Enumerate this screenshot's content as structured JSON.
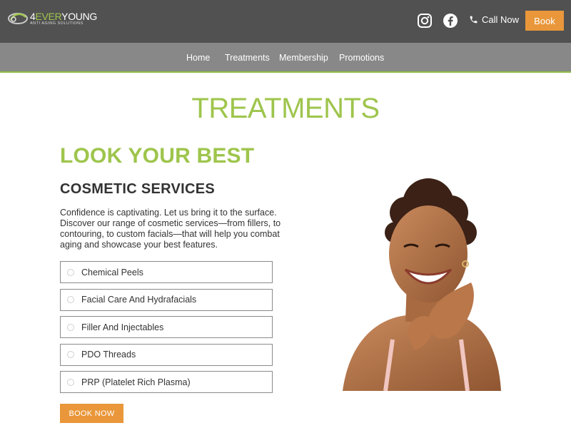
{
  "header": {
    "logo_name_prefix": "4",
    "logo_name_green": "EVER",
    "logo_name_suffix": "YOUNG",
    "logo_tagline": "ANTI AGING SOLUTIONS",
    "call_label": "Call Now",
    "book_label": "Book",
    "icons": [
      "instagram-icon",
      "facebook-icon",
      "phone-icon"
    ]
  },
  "nav": {
    "items": [
      {
        "label": "Home"
      },
      {
        "label": "Treatments"
      },
      {
        "label": "Membership"
      },
      {
        "label": "Promotions"
      }
    ]
  },
  "main": {
    "page_title": "TREATMENTS",
    "headline": "LOOK YOUR BEST",
    "subheading": "COSMETIC SERVICES",
    "intro": "Confidence is captivating. Let us bring it to the surface. Discover our range of cosmetic services—from fillers, to contouring, to custom facials—that will help you combat aging and showcase your best features.",
    "options": [
      {
        "label": "Chemical Peels"
      },
      {
        "label": "Facial Care And Hydrafacials"
      },
      {
        "label": "Filler And Injectables"
      },
      {
        "label": "PDO Threads"
      },
      {
        "label": "PRP (Platelet Rich Plasma)"
      }
    ],
    "book_now_label": "BOOK NOW"
  },
  "colors": {
    "topbar": "#515151",
    "navbar": "#888888",
    "accent_green": "#9ec54c",
    "accent_orange": "#e9973a"
  }
}
